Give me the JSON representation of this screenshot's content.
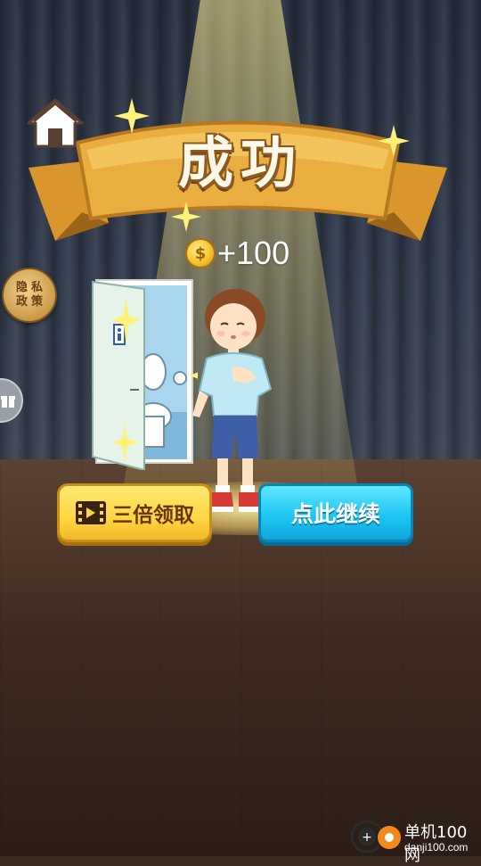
{
  "title": "成功",
  "reward": {
    "coin_symbol": "$",
    "amount": "+100"
  },
  "side": {
    "privacy_line1": "隐私",
    "privacy_line2": "政策"
  },
  "buttons": {
    "triple": "三倍领取",
    "continue": "点此继续"
  },
  "watermark": {
    "cn": "单机100网",
    "en": "danji100.com"
  },
  "colors": {
    "banner": "#e7a93b",
    "coin": "#f7c531",
    "triple_button": "#ffd640",
    "continue_button": "#1fc6f3"
  },
  "icons": [
    "home-icon",
    "video-icon",
    "sparkle-icon",
    "watermark-logo-icon"
  ]
}
